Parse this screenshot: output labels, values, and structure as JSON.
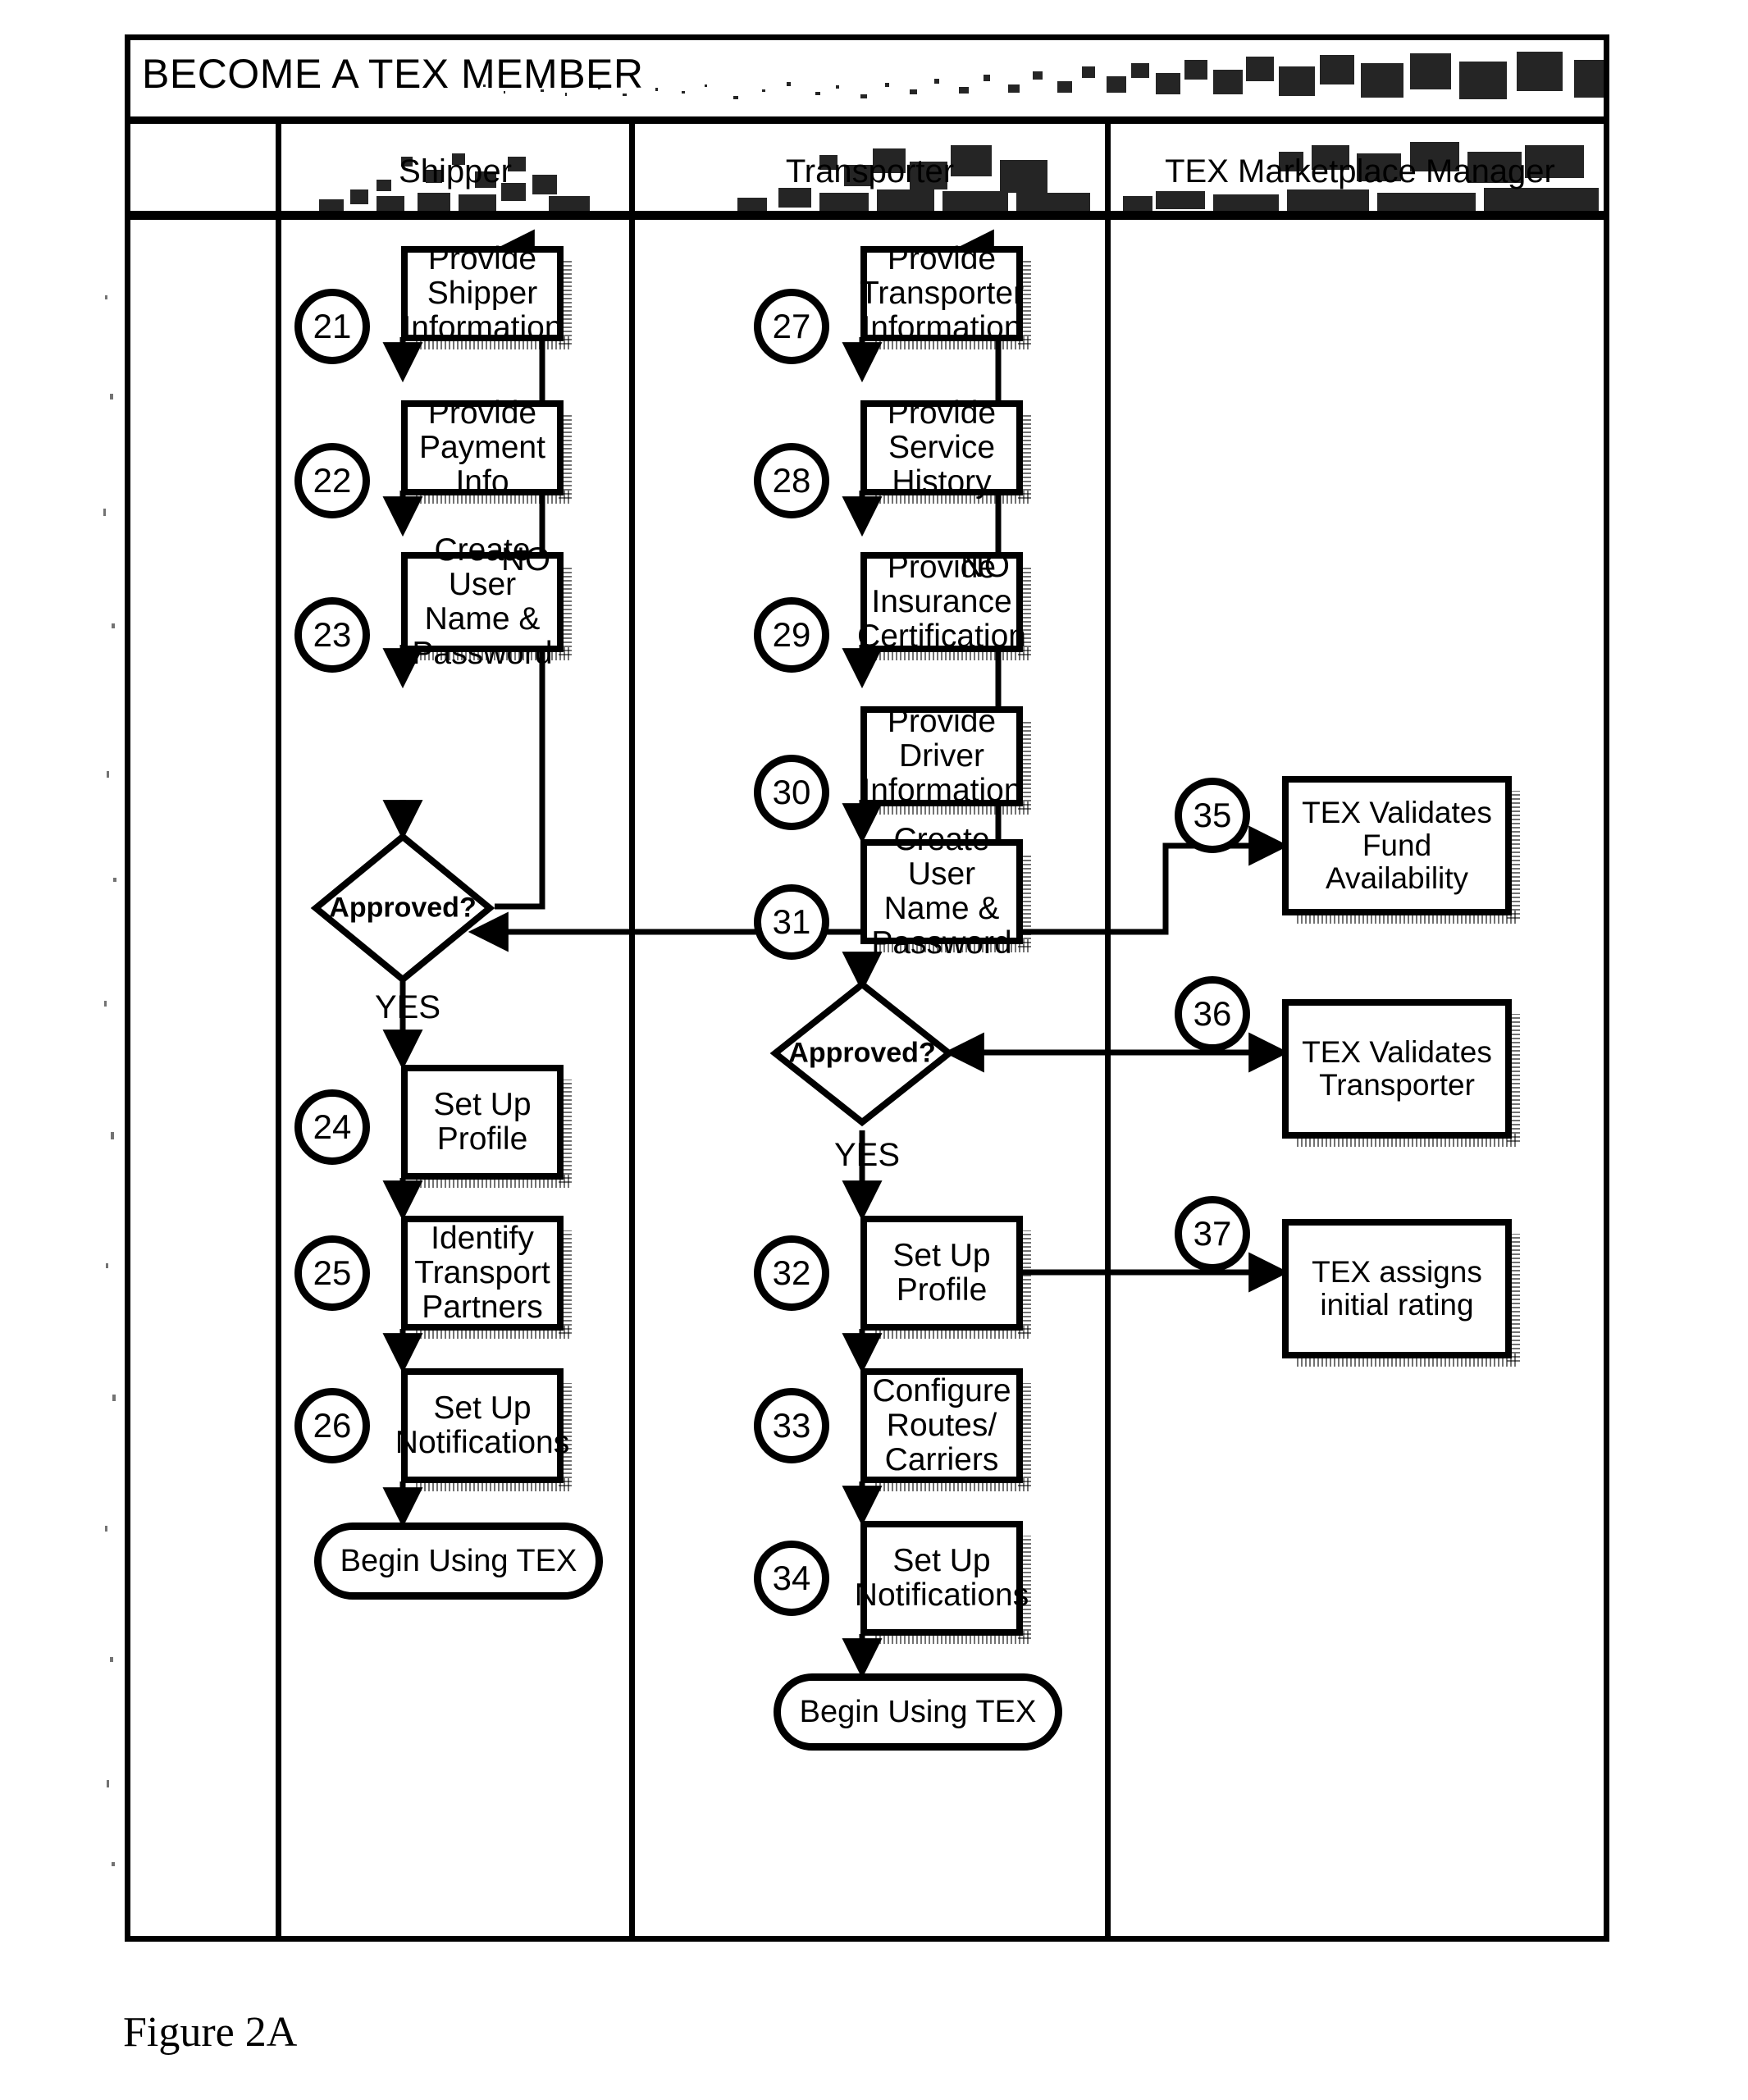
{
  "figure": {
    "title": "BECOME A TEX MEMBER",
    "caption": "Figure 2A"
  },
  "lanes": [
    {
      "id": "shipper",
      "label": "Shipper"
    },
    {
      "id": "transporter",
      "label": "Transporter"
    },
    {
      "id": "tex",
      "label": "TEX Marketplace Manager"
    }
  ],
  "shipper_lane": {
    "nodes": [
      {
        "ref": "21",
        "text": "Provide Shipper Information",
        "type": "process"
      },
      {
        "ref": "22",
        "text": "Provide Payment Info",
        "type": "process"
      },
      {
        "ref": "23",
        "text": "Create User Name & Password",
        "type": "process"
      },
      {
        "ref": "",
        "text": "Approved?",
        "type": "decision"
      },
      {
        "ref": "24",
        "text": "Set Up Profile",
        "type": "process"
      },
      {
        "ref": "25",
        "text": "Identify Transport Partners",
        "type": "process"
      },
      {
        "ref": "26",
        "text": "Set Up Notifications",
        "type": "process"
      },
      {
        "ref": "",
        "text": "Begin Using TEX",
        "type": "terminal"
      }
    ],
    "edge_labels": {
      "no": "NO",
      "yes": "YES"
    }
  },
  "transporter_lane": {
    "nodes": [
      {
        "ref": "27",
        "text": "Provide Transporter Information",
        "type": "process"
      },
      {
        "ref": "28",
        "text": "Provide Service History",
        "type": "process"
      },
      {
        "ref": "29",
        "text": "Provide Insurance Certification",
        "type": "process"
      },
      {
        "ref": "30",
        "text": "Provide Driver Information",
        "type": "process"
      },
      {
        "ref": "31",
        "text": "Create User Name & Password",
        "type": "process"
      },
      {
        "ref": "",
        "text": "Approved?",
        "type": "decision"
      },
      {
        "ref": "32",
        "text": "Set Up Profile",
        "type": "process"
      },
      {
        "ref": "33",
        "text": "Configure Routes/ Carriers",
        "type": "process"
      },
      {
        "ref": "34",
        "text": "Set Up Notifications",
        "type": "process"
      },
      {
        "ref": "",
        "text": "Begin Using TEX",
        "type": "terminal"
      }
    ],
    "edge_labels": {
      "no": "NO",
      "yes": "YES"
    }
  },
  "tex_lane": {
    "nodes": [
      {
        "ref": "35",
        "text": "TEX Validates Fund Availability",
        "type": "process"
      },
      {
        "ref": "36",
        "text": "TEX Validates Transporter",
        "type": "process"
      },
      {
        "ref": "37",
        "text": "TEX assigns initial rating",
        "type": "process"
      }
    ]
  },
  "colors": {
    "ink": "#000000",
    "paper": "#ffffff"
  }
}
